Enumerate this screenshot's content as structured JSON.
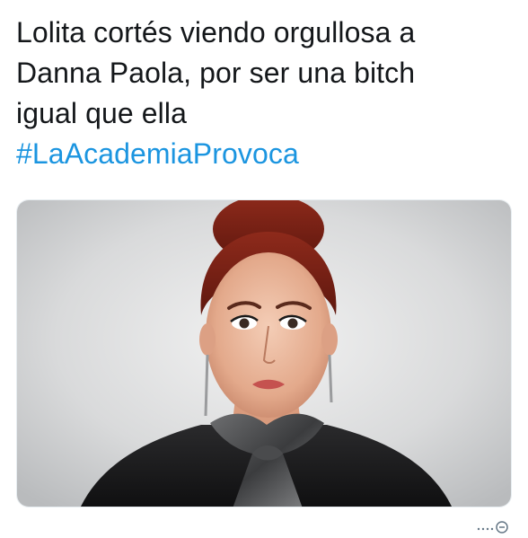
{
  "tweet": {
    "lines": [
      "Lolita cortés viendo orgullosa a",
      "Danna Paola, por ser una bitch",
      "igual que ella"
    ],
    "hashtag": "#LaAcademiaProvoca",
    "hashtag_color": "#1b95e0",
    "text_color": "#14171a"
  },
  "media": {
    "icon": "portrait-photo-icon"
  },
  "footer": {
    "icon": "more-options-icon"
  }
}
